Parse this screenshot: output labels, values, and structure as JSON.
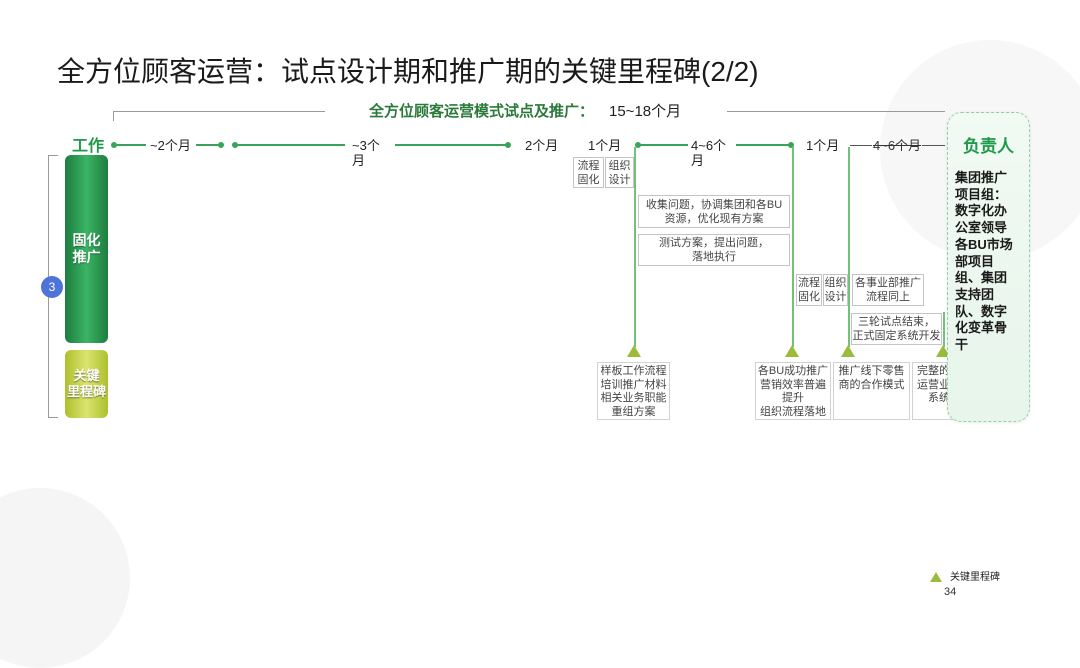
{
  "slide": {
    "title": "全方位顾客运营：试点设计期和推广期的关键里程碑(2/2)",
    "page_number": "34"
  },
  "scope": {
    "label": "全方位顾客运营模式试点及推广：",
    "duration": "15~18个月"
  },
  "timeline": {
    "row_label": "工作",
    "durations": [
      "~2个月",
      "~3个月",
      "2个月",
      "1个月",
      "4~6个月",
      "1个月",
      "4~6个月"
    ]
  },
  "phase": {
    "number": "3",
    "label_lines": [
      "固化",
      "推广"
    ],
    "milestone_label_lines": [
      "关键",
      "里程碑"
    ]
  },
  "activities": [
    {
      "lines": [
        "流程",
        "固化"
      ]
    },
    {
      "lines": [
        "组织",
        "设计"
      ]
    },
    {
      "lines": [
        "收集问题，协调集团和各BU",
        "资源，优化现有方案"
      ]
    },
    {
      "lines": [
        "测试方案，提出问题，",
        "落地执行"
      ]
    },
    {
      "lines": [
        "流程",
        "固化"
      ]
    },
    {
      "lines": [
        "组织",
        "设计"
      ]
    },
    {
      "lines": [
        "各事业部推广",
        "流程同上"
      ]
    },
    {
      "lines": [
        "三轮试点结束，",
        "正式固定系统开发"
      ]
    }
  ],
  "milestones": [
    {
      "lines": [
        "样板工作流程",
        "培训推广材料",
        "相关业务职能",
        "重组方案"
      ]
    },
    {
      "lines": [
        "各BU成功推广",
        "营销效率普遍",
        "提升",
        "组织流程落地"
      ]
    },
    {
      "lines": [
        "推广线下零售",
        "商的合作模式"
      ]
    },
    {
      "lines": [
        "完整的个人化",
        "运营业务模式",
        "系统支持"
      ]
    }
  ],
  "owner": {
    "title": "负责人",
    "group": "集团推广项目组：",
    "members": "数字化办公室领导各BU市场部项目组、集团支持团队、数字化变革骨干"
  },
  "legend": {
    "milestone": "关键里程碑"
  },
  "colors": {
    "accent_green": "#1f9a4a",
    "timeline_green": "#3aa35a",
    "milestone_marker": "#9dbb3a",
    "phase_badge": "#4f74d9"
  }
}
